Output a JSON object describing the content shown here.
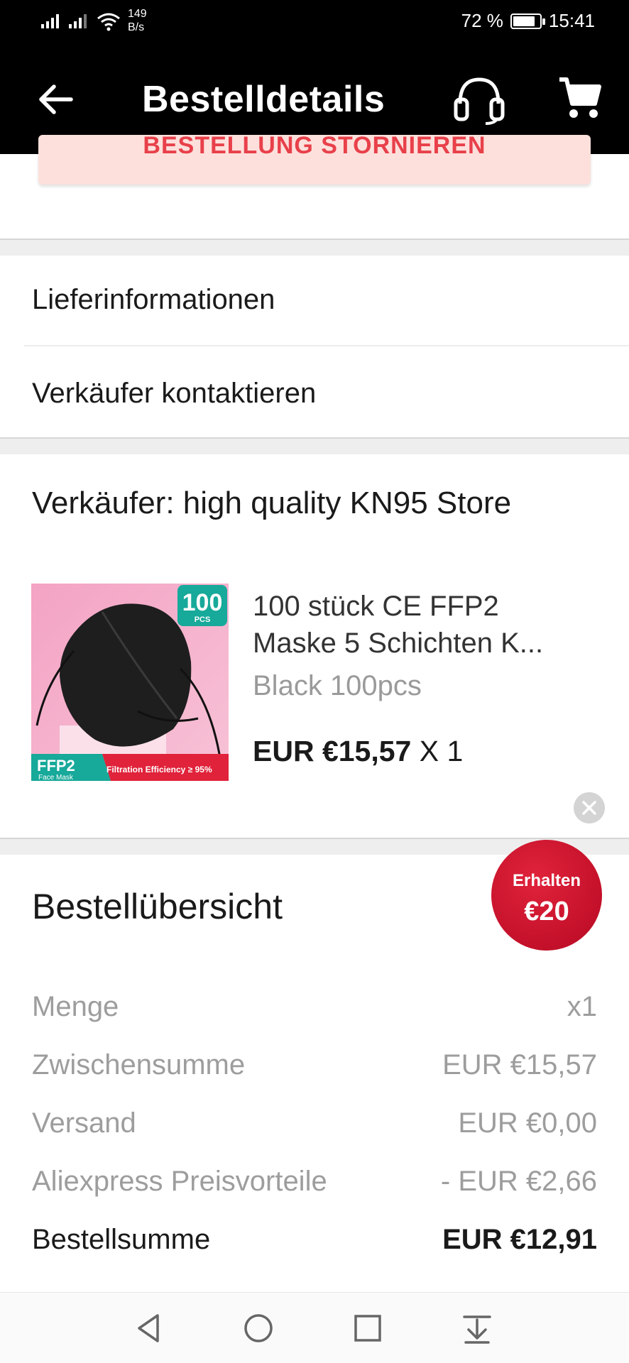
{
  "status_bar": {
    "net_speed_value": "149",
    "net_speed_unit": "B/s",
    "battery": "72 %",
    "time": "15:41",
    "battery_level": 0.72
  },
  "header": {
    "title": "Bestelldetails",
    "icons": [
      "back-arrow-icon",
      "headset-icon",
      "cart-icon"
    ]
  },
  "cancel_button": {
    "label": "BESTELLUNG STORNIEREN"
  },
  "menu": {
    "delivery_info": "Lieferinformationen",
    "contact_seller": "Verkäufer kontaktieren"
  },
  "seller": {
    "title": "Verkäufer: high quality KN95 Store"
  },
  "product": {
    "title_line1": "100 stück CE FFP2",
    "title_line2": "Maske 5 Schichten K...",
    "variant": "Black 100pcs",
    "price": "EUR €15,57",
    "quantity": "X 1",
    "image_badge_count": "100",
    "image_badge_unit": "PCS",
    "image_tag_main": "FFP2",
    "image_tag_sub": "Face Mask",
    "image_filtration": "Filtration Efficiency ≥ 95%"
  },
  "coupon": {
    "label": "Erhalten",
    "amount": "€20"
  },
  "summary": {
    "title": "Bestellübersicht",
    "rows": [
      {
        "label": "Menge",
        "value": "x1"
      },
      {
        "label": "Zwischensumme",
        "value": "EUR €15,57"
      },
      {
        "label": "Versand",
        "value": "EUR €0,00"
      },
      {
        "label": "Aliexpress Preisvorteile",
        "value": "- EUR €2,66"
      }
    ],
    "total": {
      "label": "Bestellsumme",
      "value": "EUR €12,91"
    }
  },
  "nav": {
    "icons": [
      "nav-back-icon",
      "nav-home-icon",
      "nav-recents-icon",
      "nav-notifications-icon"
    ]
  },
  "colors": {
    "header_bg": "#000000",
    "cancel_bg": "#fde0dc",
    "cancel_text": "#e8404a",
    "coupon_bg": "#c4102a",
    "muted_text": "#9d9d9d"
  }
}
